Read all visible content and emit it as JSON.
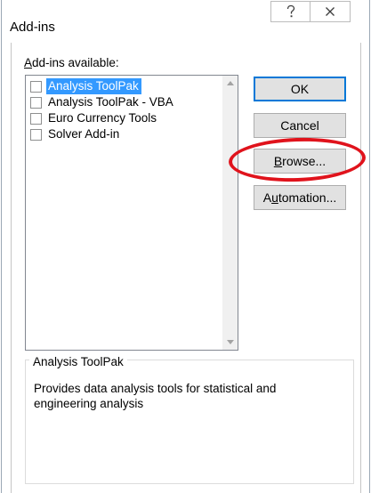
{
  "window": {
    "title": "Add-ins",
    "help_icon": "question-mark-icon",
    "close_icon": "close-x-icon"
  },
  "addins": {
    "label_accesskey": "A",
    "label_rest": "dd-ins available:",
    "items": [
      {
        "label": "Analysis ToolPak",
        "checked": false,
        "selected": true
      },
      {
        "label": "Analysis ToolPak - VBA",
        "checked": false,
        "selected": false
      },
      {
        "label": "Euro Currency Tools",
        "checked": false,
        "selected": false
      },
      {
        "label": "Solver Add-in",
        "checked": false,
        "selected": false
      }
    ]
  },
  "buttons": {
    "ok": "OK",
    "cancel": "Cancel",
    "browse_accesskey": "B",
    "browse_rest": "rowse...",
    "automation_accesskey": "u",
    "automation_prefix": "A",
    "automation_rest": "tomation..."
  },
  "details": {
    "title": "Analysis ToolPak",
    "description": "Provides data analysis tools for statistical and engineering analysis"
  },
  "colors": {
    "selection": "#3399ff",
    "annotation_ring": "#e0131c",
    "focus_border": "#0078d7"
  }
}
